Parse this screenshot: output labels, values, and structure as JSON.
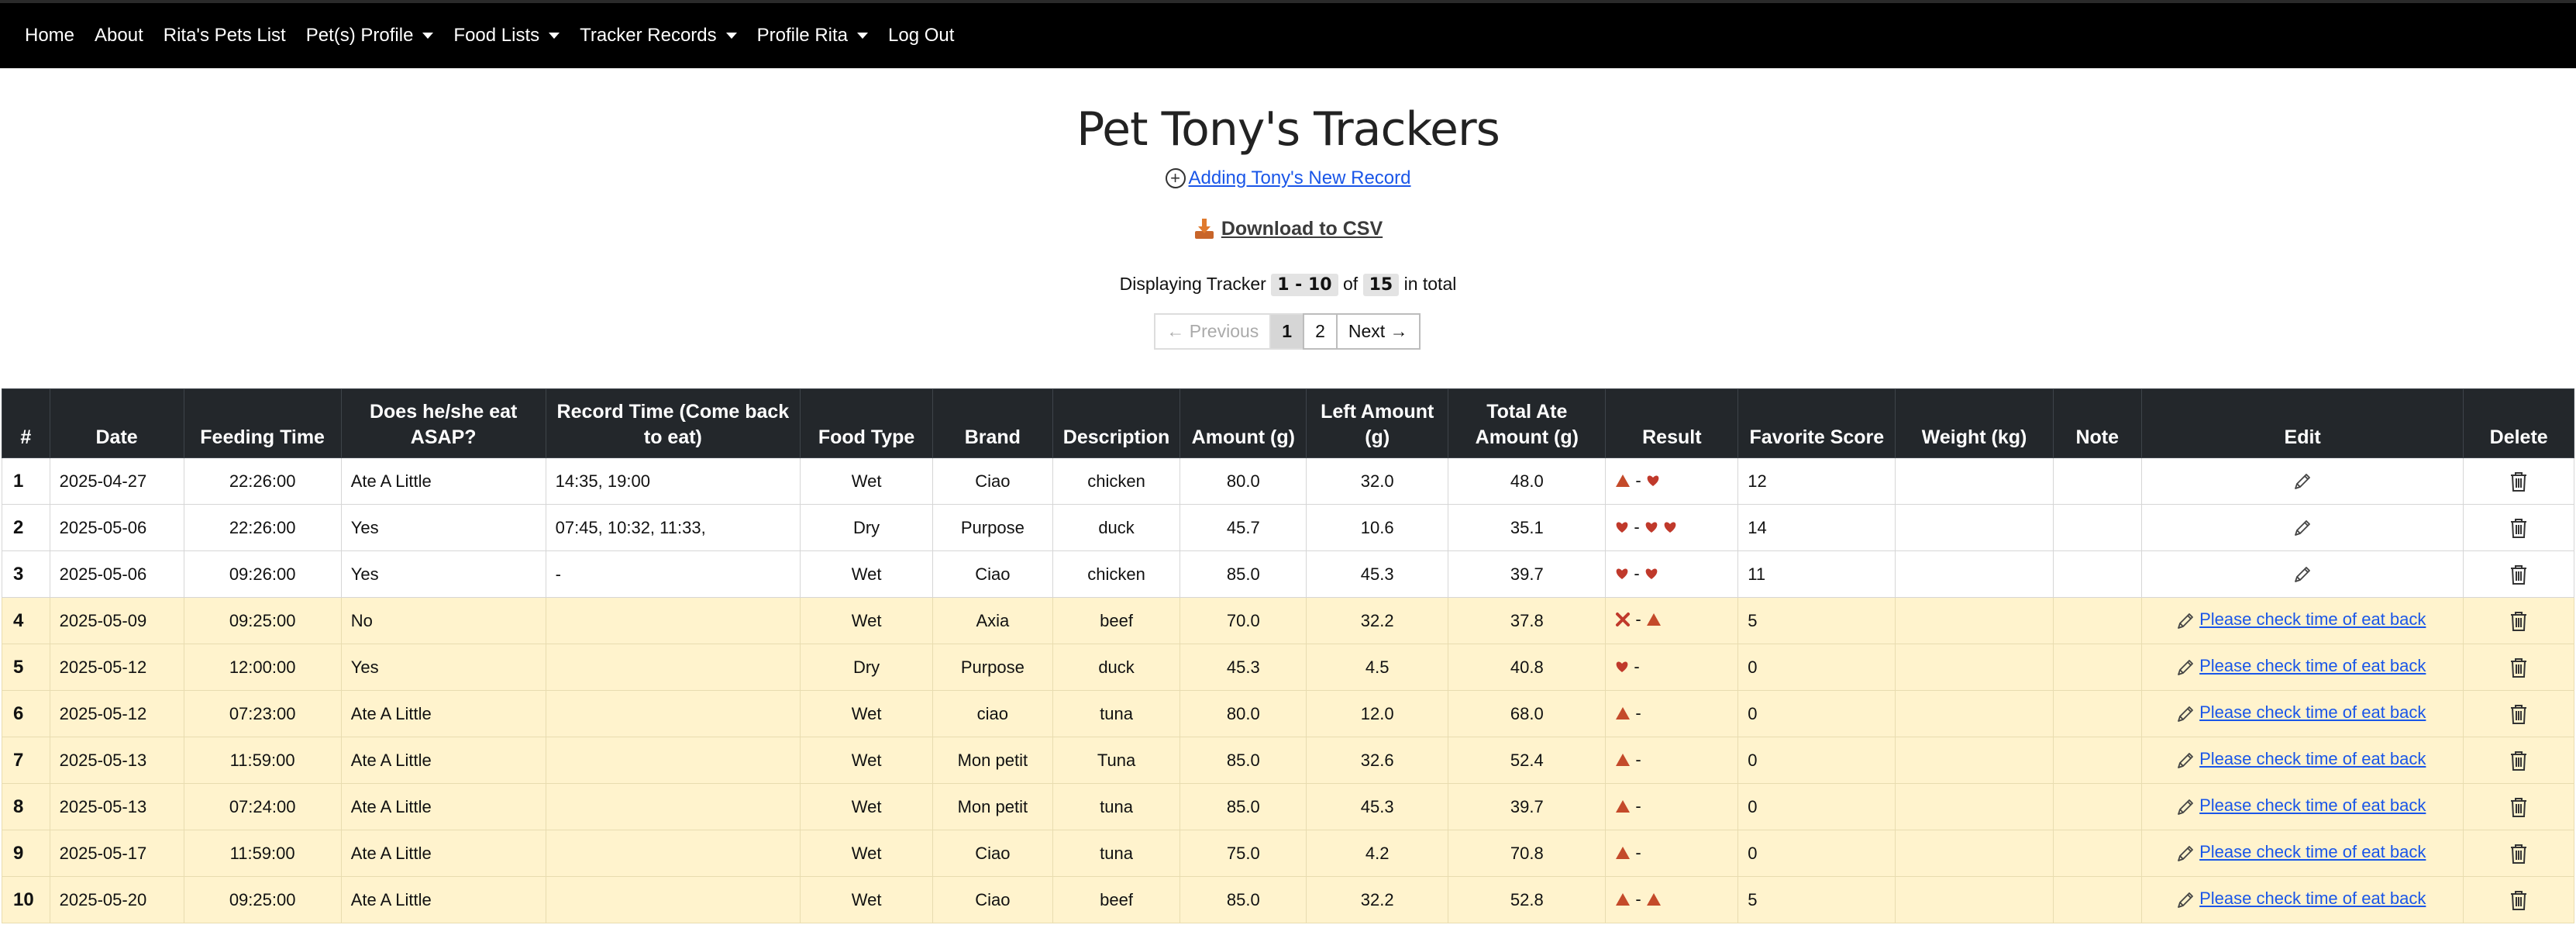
{
  "nav": {
    "items": [
      {
        "label": "Home",
        "dropdown": false
      },
      {
        "label": "About",
        "dropdown": false
      },
      {
        "label": "Rita's Pets List",
        "dropdown": false
      },
      {
        "label": "Pet(s) Profile",
        "dropdown": true
      },
      {
        "label": "Food Lists",
        "dropdown": true
      },
      {
        "label": "Tracker Records",
        "dropdown": true
      },
      {
        "label": "Profile Rita",
        "dropdown": true
      },
      {
        "label": "Log Out",
        "dropdown": false
      }
    ]
  },
  "page": {
    "title": "Pet Tony's Trackers",
    "add_link": "Adding Tony's New Record",
    "download_csv": "Download to CSV",
    "displaying_prefix": "Displaying Tracker",
    "range": "1 - 10",
    "of": "of",
    "total": "15",
    "total_suffix": "in total"
  },
  "pagination": {
    "previous": "← Previous",
    "pages": [
      "1",
      "2"
    ],
    "current": "1",
    "next": "Next →"
  },
  "table": {
    "headers": [
      "#",
      "Date",
      "Feeding Time",
      "Does he/she eat ASAP?",
      "Record Time (Come back to eat)",
      "Food Type",
      "Brand",
      "Description",
      "Amount (g)",
      "Left Amount (g)",
      "Total Ate Amount (g)",
      "Result",
      "Favorite Score",
      "Weight (kg)",
      "Note",
      "Edit",
      "Delete"
    ],
    "edit_link_label": "Please check time of eat back",
    "rows": [
      {
        "num": "1",
        "date": "2025-04-27",
        "time": "22:26:00",
        "asap": "Ate A Little",
        "record": "14:35, 19:00",
        "type": "Wet",
        "brand": "Ciao",
        "desc": "chicken",
        "amount": "80.0",
        "left": "32.0",
        "ate": "48.0",
        "result": [
          "tri",
          "-",
          "heart"
        ],
        "score": "12",
        "weight": "",
        "note": "",
        "edit": "icon",
        "highlight": false
      },
      {
        "num": "2",
        "date": "2025-05-06",
        "time": "22:26:00",
        "asap": "Yes",
        "record": "07:45, 10:32, 11:33,",
        "type": "Dry",
        "brand": "Purpose",
        "desc": "duck",
        "amount": "45.7",
        "left": "10.6",
        "ate": "35.1",
        "result": [
          "heart",
          "-",
          "heart",
          "heart"
        ],
        "score": "14",
        "weight": "",
        "note": "",
        "edit": "icon",
        "highlight": false
      },
      {
        "num": "3",
        "date": "2025-05-06",
        "time": "09:26:00",
        "asap": "Yes",
        "record": "-",
        "type": "Wet",
        "brand": "Ciao",
        "desc": "chicken",
        "amount": "85.0",
        "left": "45.3",
        "ate": "39.7",
        "result": [
          "heart",
          "-",
          "heart"
        ],
        "score": "11",
        "weight": "",
        "note": "",
        "edit": "icon",
        "highlight": false
      },
      {
        "num": "4",
        "date": "2025-05-09",
        "time": "09:25:00",
        "asap": "No",
        "record": "",
        "type": "Wet",
        "brand": "Axia",
        "desc": "beef",
        "amount": "70.0",
        "left": "32.2",
        "ate": "37.8",
        "result": [
          "x",
          "-",
          "tri"
        ],
        "score": "5",
        "weight": "",
        "note": "",
        "edit": "link",
        "highlight": true
      },
      {
        "num": "5",
        "date": "2025-05-12",
        "time": "12:00:00",
        "asap": "Yes",
        "record": "",
        "type": "Dry",
        "brand": "Purpose",
        "desc": "duck",
        "amount": "45.3",
        "left": "4.5",
        "ate": "40.8",
        "result": [
          "heart",
          "-"
        ],
        "score": "0",
        "weight": "",
        "note": "",
        "edit": "link",
        "highlight": true
      },
      {
        "num": "6",
        "date": "2025-05-12",
        "time": "07:23:00",
        "asap": "Ate A Little",
        "record": "",
        "type": "Wet",
        "brand": "ciao",
        "desc": "tuna",
        "amount": "80.0",
        "left": "12.0",
        "ate": "68.0",
        "result": [
          "tri",
          "-"
        ],
        "score": "0",
        "weight": "",
        "note": "",
        "edit": "link",
        "highlight": true
      },
      {
        "num": "7",
        "date": "2025-05-13",
        "time": "11:59:00",
        "asap": "Ate A Little",
        "record": "",
        "type": "Wet",
        "brand": "Mon petit",
        "desc": "Tuna",
        "amount": "85.0",
        "left": "32.6",
        "ate": "52.4",
        "result": [
          "tri",
          "-"
        ],
        "score": "0",
        "weight": "",
        "note": "",
        "edit": "link",
        "highlight": true
      },
      {
        "num": "8",
        "date": "2025-05-13",
        "time": "07:24:00",
        "asap": "Ate A Little",
        "record": "",
        "type": "Wet",
        "brand": "Mon petit",
        "desc": "tuna",
        "amount": "85.0",
        "left": "45.3",
        "ate": "39.7",
        "result": [
          "tri",
          "-"
        ],
        "score": "0",
        "weight": "",
        "note": "",
        "edit": "link",
        "highlight": true
      },
      {
        "num": "9",
        "date": "2025-05-17",
        "time": "11:59:00",
        "asap": "Ate A Little",
        "record": "",
        "type": "Wet",
        "brand": "Ciao",
        "desc": "tuna",
        "amount": "75.0",
        "left": "4.2",
        "ate": "70.8",
        "result": [
          "tri",
          "-"
        ],
        "score": "0",
        "weight": "",
        "note": "",
        "edit": "link",
        "highlight": true
      },
      {
        "num": "10",
        "date": "2025-05-20",
        "time": "09:25:00",
        "asap": "Ate A Little",
        "record": "",
        "type": "Wet",
        "brand": "Ciao",
        "desc": "beef",
        "amount": "85.0",
        "left": "32.2",
        "ate": "52.8",
        "result": [
          "tri",
          "-",
          "tri"
        ],
        "score": "5",
        "weight": "",
        "note": "",
        "edit": "link",
        "highlight": true
      }
    ]
  },
  "colors": {
    "nav_bg": "#000000",
    "header_bg": "#23272b",
    "highlight_row": "#fff3cd",
    "link": "#1a56e8",
    "heart": "#c0392b",
    "triangle": "#c44a2a"
  }
}
